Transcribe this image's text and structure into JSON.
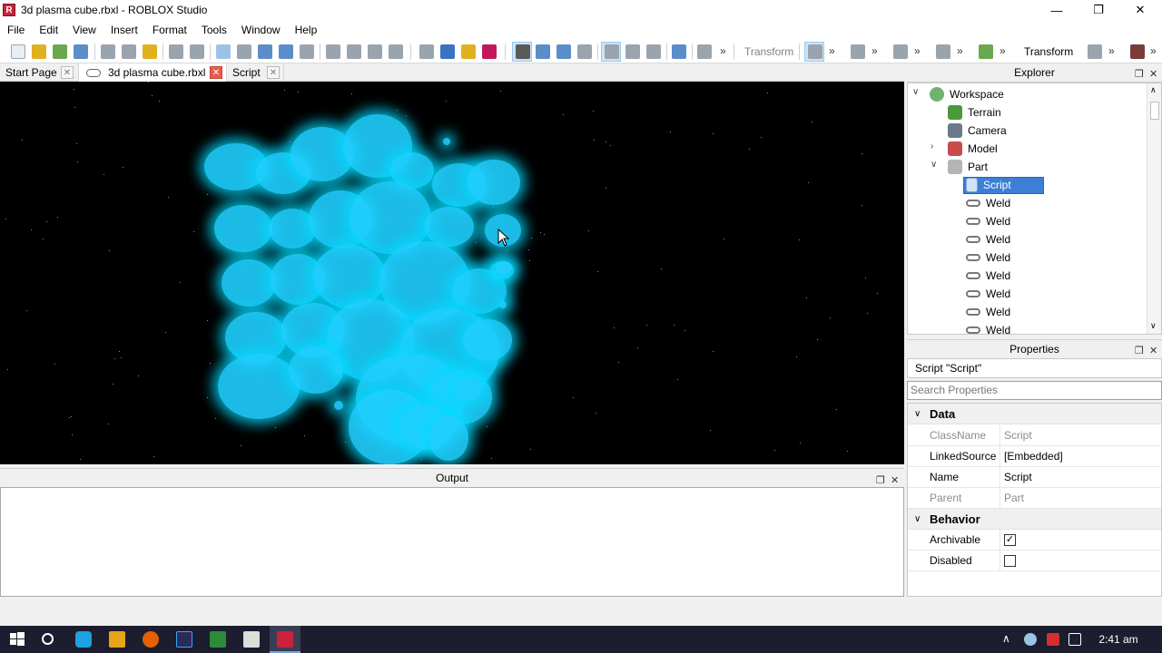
{
  "window": {
    "title": "3d plasma cube.rbxl - ROBLOX Studio",
    "minimize_glyph": "—",
    "restore_glyph": "❐",
    "close_glyph": "✕"
  },
  "menu": [
    "File",
    "Edit",
    "View",
    "Insert",
    "Format",
    "Tools",
    "Window",
    "Help"
  ],
  "toolbar": {
    "transform_label_1": "Transform",
    "transform_label_2": "Transform",
    "overflow_glyph": "»"
  },
  "tabs": [
    {
      "label": "Start Page"
    },
    {
      "label": "3d plasma cube.rbxl"
    },
    {
      "label": "Script"
    }
  ],
  "output": {
    "title": "Output"
  },
  "explorer": {
    "title": "Explorer",
    "items": [
      {
        "label": "Workspace",
        "icon": "workspace-icon"
      },
      {
        "label": "Terrain",
        "icon": "terrain-icon"
      },
      {
        "label": "Camera",
        "icon": "camera-icon"
      },
      {
        "label": "Model",
        "icon": "model-icon"
      },
      {
        "label": "Part",
        "icon": "part-icon"
      },
      {
        "label": "Script",
        "icon": "script-icon"
      },
      {
        "label": "Weld",
        "icon": "weld-icon"
      },
      {
        "label": "Weld",
        "icon": "weld-icon"
      },
      {
        "label": "Weld",
        "icon": "weld-icon"
      },
      {
        "label": "Weld",
        "icon": "weld-icon"
      },
      {
        "label": "Weld",
        "icon": "weld-icon"
      },
      {
        "label": "Weld",
        "icon": "weld-icon"
      },
      {
        "label": "Weld",
        "icon": "weld-icon"
      },
      {
        "label": "Weld",
        "icon": "weld-icon"
      }
    ]
  },
  "properties": {
    "title": "Properties",
    "selected_object": "Script \"Script\"",
    "search_placeholder": "Search Properties",
    "categories": [
      {
        "name": "Data",
        "rows": [
          {
            "name": "ClassName",
            "value": "Script"
          },
          {
            "name": "LinkedSource",
            "value": "[Embedded]"
          },
          {
            "name": "Name",
            "value": "Script"
          },
          {
            "name": "Parent",
            "value": "Part"
          }
        ]
      },
      {
        "name": "Behavior",
        "rows": [
          {
            "name": "Archivable",
            "value": true
          },
          {
            "name": "Disabled",
            "value": false
          }
        ]
      }
    ]
  },
  "taskbar": {
    "time": "2:41 am",
    "chevron_up": "∧",
    "check_mark": "✓"
  },
  "colors": {
    "plasma": "#1fd0ff",
    "selection": "#3d7ed6",
    "taskbar": "#1c1d2e"
  }
}
